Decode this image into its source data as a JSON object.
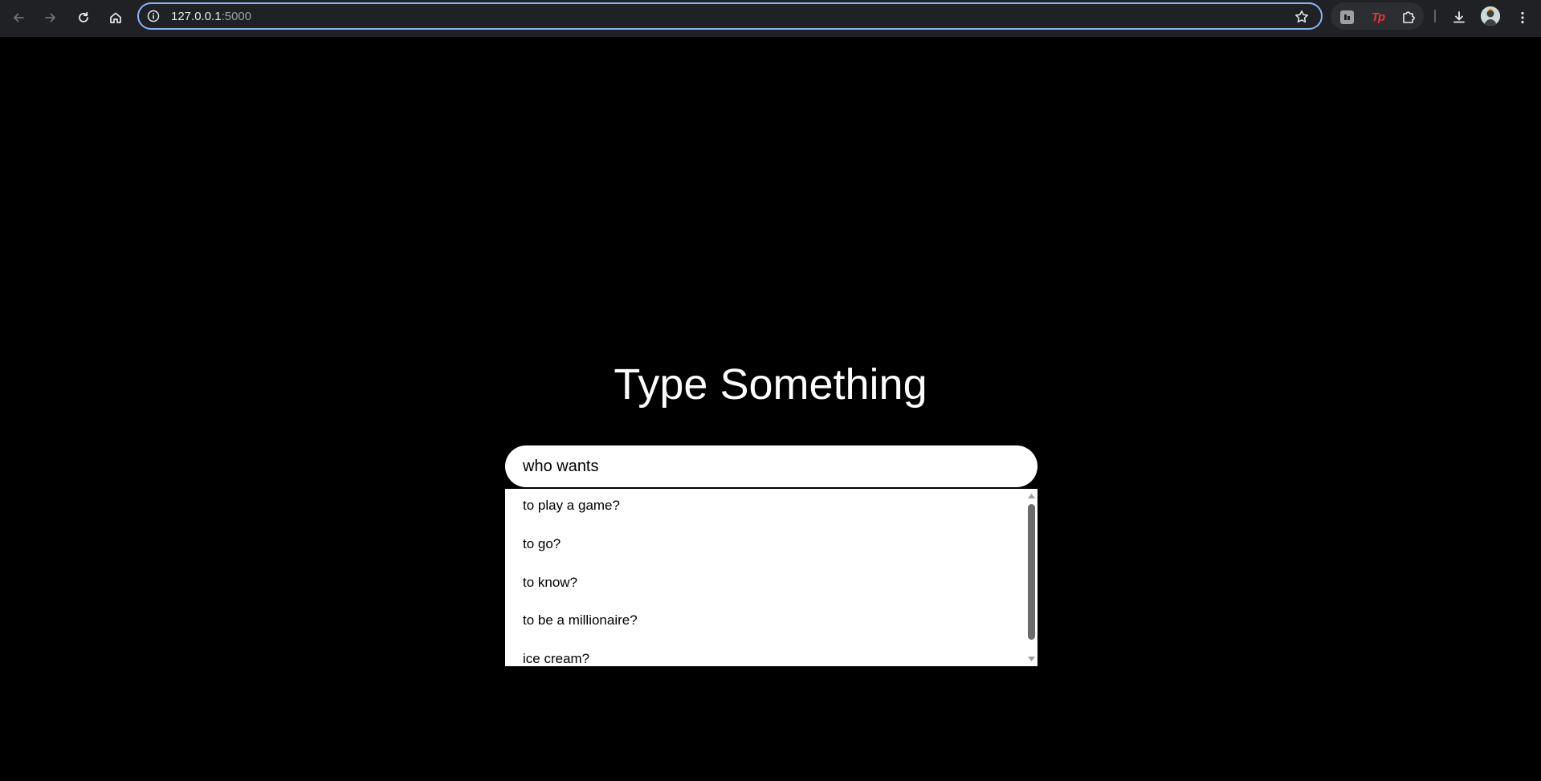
{
  "browser": {
    "url_host": "127.0.0.1",
    "url_port": ":5000",
    "icons": {
      "back": "arrow-left-icon",
      "forward": "arrow-right-icon",
      "reload": "reload-icon",
      "home": "home-icon",
      "site_info": "info-icon",
      "bookmark": "star-icon",
      "extension_1": "extension-tile-icon",
      "extension_2": "tp-extension-icon",
      "extensions_menu": "puzzle-icon",
      "downloads": "download-icon",
      "profile": "avatar",
      "menu": "kebab-menu-icon"
    },
    "extension_2_label": "Tp"
  },
  "page": {
    "title": "Type Something",
    "search": {
      "value": "who wants",
      "placeholder": ""
    },
    "suggestions": [
      "to play a game?",
      "to go?",
      "to know?",
      "to be a millionaire?",
      "ice cream?"
    ]
  },
  "colors": {
    "page_background": "#000000",
    "title_text": "#ffffff",
    "input_background": "#ffffff",
    "omnibox_focus_border": "#8ab4f8",
    "tp_extension": "#e53935"
  }
}
